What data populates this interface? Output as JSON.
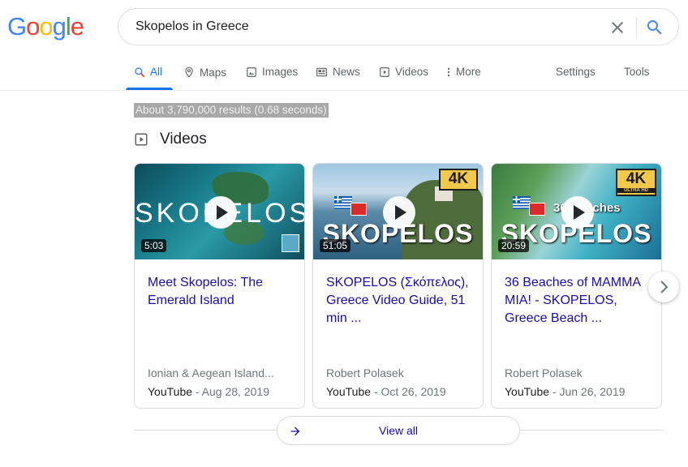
{
  "logo": {
    "letters": [
      "G",
      "o",
      "o",
      "g",
      "l",
      "e"
    ],
    "colors": [
      "#4285f4",
      "#ea4335",
      "#fbbc05",
      "#4285f4",
      "#34a853",
      "#ea4335"
    ]
  },
  "search": {
    "query": "Skopelos in Greece"
  },
  "tabs": [
    {
      "label": "All",
      "icon": "search-icon"
    },
    {
      "label": "Maps",
      "icon": "map-pin-icon"
    },
    {
      "label": "Images",
      "icon": "image-icon"
    },
    {
      "label": "News",
      "icon": "newspaper-icon"
    },
    {
      "label": "Videos",
      "icon": "play-square-icon"
    },
    {
      "label": "More",
      "icon": "more-vert-icon"
    },
    {
      "label": "Settings"
    },
    {
      "label": "Tools"
    }
  ],
  "stats": "About 3,790,000 results (0.68 seconds)",
  "videos": {
    "heading": "Videos",
    "view_all": "View all",
    "cards": [
      {
        "thumb_text": "SKOPELOS",
        "duration": "5:03",
        "title": "Meet Skopelos: The Emerald Island",
        "source": "Ionian & Aegean Island...",
        "platform": "YouTube",
        "date": " - Aug 28, 2019"
      },
      {
        "thumb_text": "SKOPELOS",
        "badge": "4K",
        "duration": "51:05",
        "title": "SKOPELOS (Σκόπελος), Greece Video Guide, 51 min ...",
        "source": "Robert Polasek",
        "platform": "YouTube",
        "date": " - Oct 26, 2019"
      },
      {
        "thumb_text": "SKOPELOS",
        "thumb_sub": "36 Beaches",
        "badge": "4K",
        "badge_sub": "ULTRA HD",
        "duration": "20:59",
        "title": "36 Beaches of MAMMA MIA! - SKOPELOS, Greece Beach ...",
        "source": "Robert Polasek",
        "platform": "YouTube",
        "date": " - Jun 26, 2019"
      }
    ]
  },
  "colors": {
    "link": "#1a0dab",
    "accent": "#1a73e8",
    "muted": "#70757a"
  }
}
